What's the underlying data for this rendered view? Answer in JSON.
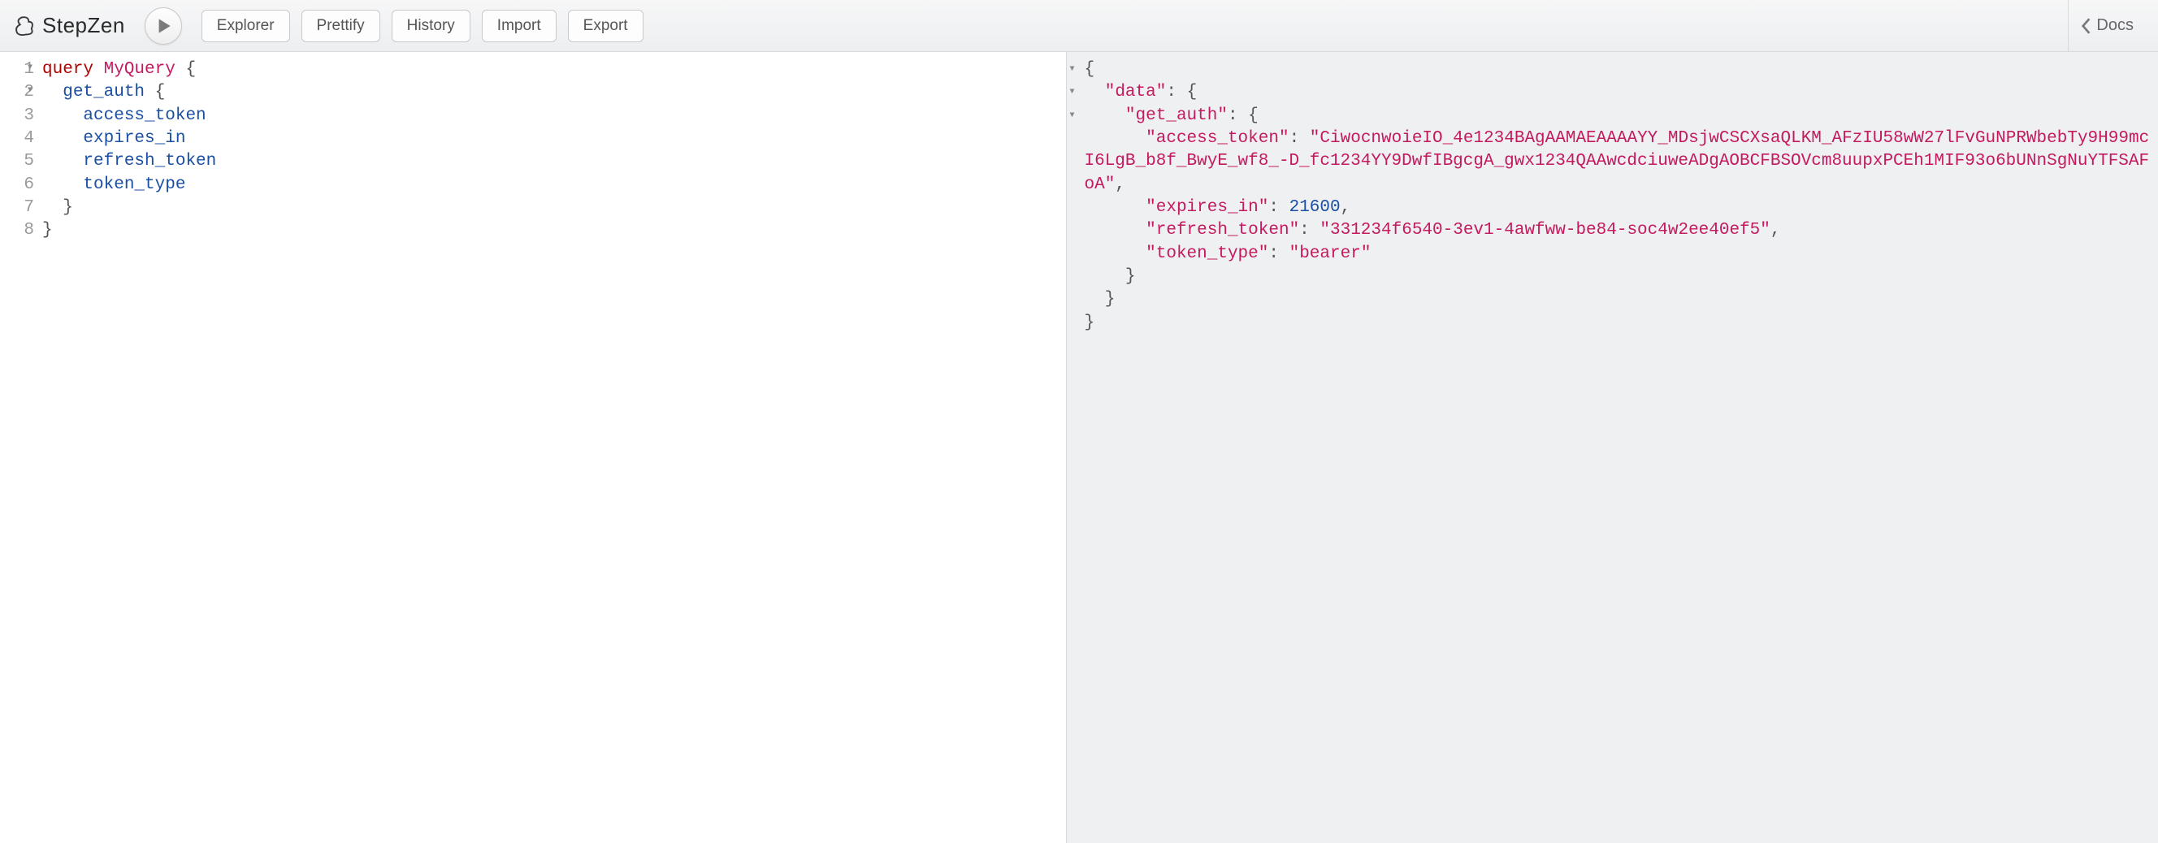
{
  "brand": {
    "name": "StepZen"
  },
  "toolbar": {
    "explorer": "Explorer",
    "prettify": "Prettify",
    "history": "History",
    "import": "Import",
    "export": "Export",
    "docs": "Docs"
  },
  "editor": {
    "line_numbers": [
      "1",
      "2",
      "3",
      "4",
      "5",
      "6",
      "7",
      "8"
    ],
    "query_keyword": "query",
    "operation_name": "MyQuery",
    "root_field": "get_auth",
    "fields": [
      "access_token",
      "expires_in",
      "refresh_token",
      "token_type"
    ]
  },
  "result": {
    "data_key": "data",
    "root_field": "get_auth",
    "access_token_key": "access_token",
    "access_token_value": "CiwocnwoieIO_4e1234BAgAAMAEAAAAYY_MDsjwCSCXsaQLKM_AFzIU58wW27lFvGuNPRWbebTy9H99mcI6LgB_b8f_BwyE_wf8_-D_fc1234YY9DwfIBgcgA_gwx1234QAAwcdciuweADgAOBCFBSOVcm8uupxPCEh1MIF93o6bUNnSgNuYTFSAFoA",
    "expires_in_key": "expires_in",
    "expires_in_value": 21600,
    "refresh_token_key": "refresh_token",
    "refresh_token_value": "331234f6540-3ev1-4awfww-be84-soc4w2ee40ef5",
    "token_type_key": "token_type",
    "token_type_value": "bearer"
  }
}
